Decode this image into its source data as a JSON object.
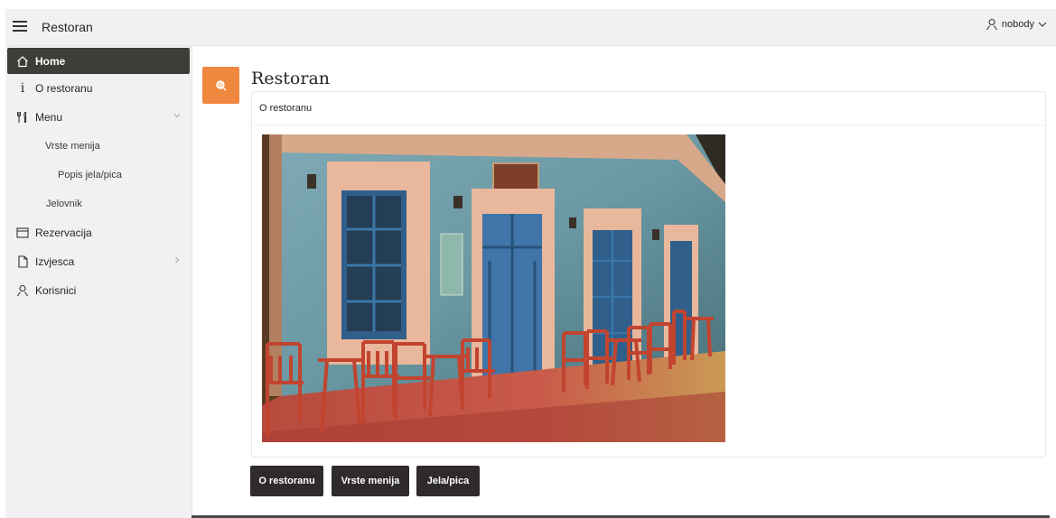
{
  "header": {
    "app_title": "Restoran",
    "user_name": "nobody"
  },
  "sidebar": {
    "items": [
      {
        "label": "Home",
        "icon": "home-icon",
        "active": true
      },
      {
        "label": "O restoranu",
        "icon": "info-icon"
      },
      {
        "label": "Menu",
        "icon": "utensils-icon",
        "expanded": true,
        "children": [
          {
            "label": "Vrste menija"
          },
          {
            "label": "Popis jela/pica"
          },
          {
            "label": "Jelovnik"
          }
        ]
      },
      {
        "label": "Rezervacija",
        "icon": "calendar-icon"
      },
      {
        "label": "Izvjesca",
        "icon": "document-icon"
      },
      {
        "label": "Korisnici",
        "icon": "user-icon"
      }
    ]
  },
  "main": {
    "page_title": "Restoran",
    "region_title": "O restoranu",
    "buttons": [
      {
        "label": "O restoranu"
      },
      {
        "label": "Vrste menija"
      },
      {
        "label": "Jela/pica"
      }
    ]
  },
  "colors": {
    "accent": "#f0873f",
    "active_nav": "#3b3f37",
    "button": "#2e2b2a"
  }
}
